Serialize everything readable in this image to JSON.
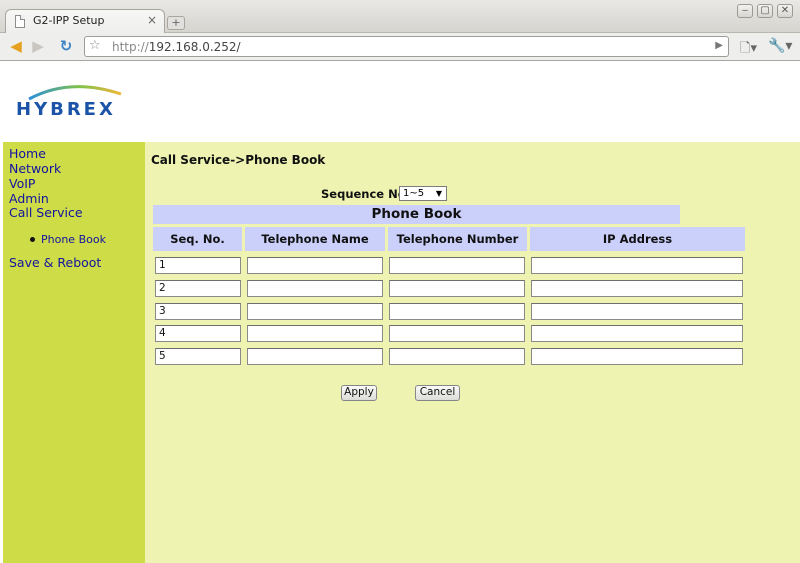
{
  "browser": {
    "tab_title": "G2-IPP Setup",
    "tab_close": "×",
    "new_tab": "+",
    "url_proto": "http://",
    "url_host": "192.168.0.252/",
    "window_buttons": [
      "‒",
      "▢",
      "✕"
    ]
  },
  "brand": {
    "logo_text": "HYBREX",
    "colors": {
      "logo_blue": "#1b53a8",
      "arc_start": "#2c8fd8",
      "arc_end": "#f0b63a"
    }
  },
  "sidebar": {
    "items": [
      {
        "label": "Home"
      },
      {
        "label": "Network"
      },
      {
        "label": "VoIP"
      },
      {
        "label": "Admin"
      },
      {
        "label": "Call Service"
      }
    ],
    "sub_items": [
      {
        "label": "Phone Book"
      }
    ],
    "save_reboot": "Save & Reboot"
  },
  "main": {
    "breadcrumb": "Call Service->Phone Book",
    "sequence_label": "Sequence No.",
    "sequence_value": "1~5",
    "table_title": "Phone Book",
    "columns": [
      "Seq. No.",
      "Telephone Name",
      "Telephone Number",
      "IP Address"
    ],
    "rows": [
      {
        "seq": "1",
        "name": "",
        "number": "",
        "ip": ""
      },
      {
        "seq": "2",
        "name": "",
        "number": "",
        "ip": ""
      },
      {
        "seq": "3",
        "name": "",
        "number": "",
        "ip": ""
      },
      {
        "seq": "4",
        "name": "",
        "number": "",
        "ip": ""
      },
      {
        "seq": "5",
        "name": "",
        "number": "",
        "ip": ""
      }
    ],
    "apply_label": "Apply",
    "cancel_label": "Cancel"
  },
  "colors": {
    "sidebar_bg": "#cddc47",
    "content_bg": "#eef3b2",
    "header_cell_bg": "#cbd0fb",
    "link": "#1313a0"
  }
}
